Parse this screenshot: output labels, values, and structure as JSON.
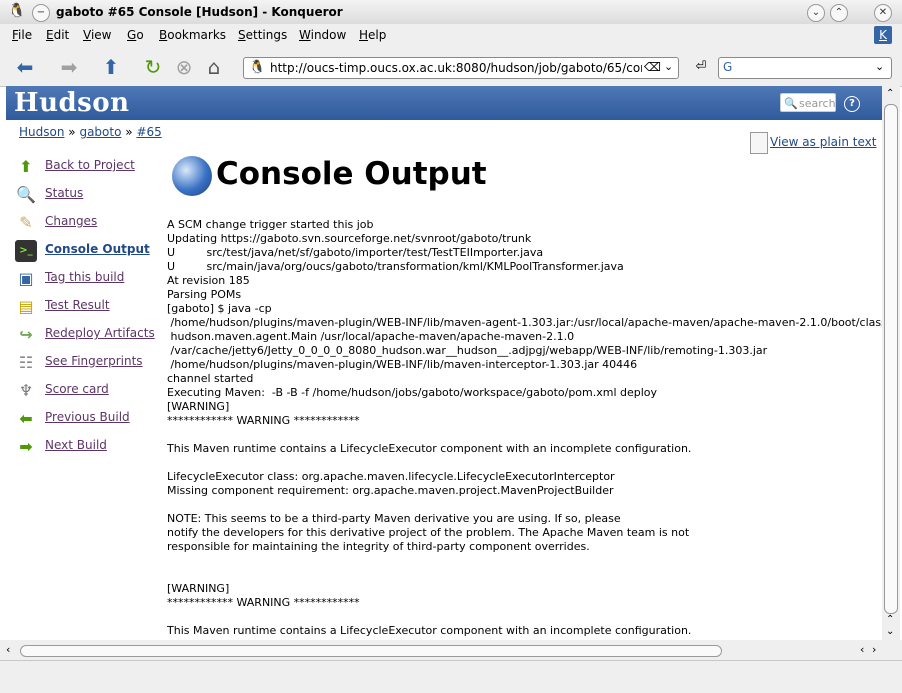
{
  "window": {
    "title": "gaboto #65 Console [Hudson] - Konqueror"
  },
  "menu": [
    "File",
    "Edit",
    "View",
    "Go",
    "Bookmarks",
    "Settings",
    "Window",
    "Help"
  ],
  "address": {
    "url": "http://oucs-timp.oucs.ox.ac.uk:8080/hudson/job/gaboto/65/console"
  },
  "hudson": {
    "logo": "Hudson",
    "search_placeholder": "search",
    "help": "?"
  },
  "breadcrumb": {
    "home": "Hudson",
    "sep1": "»",
    "job": "gaboto",
    "sep2": "»",
    "build": "#65"
  },
  "sidebar": {
    "items": [
      {
        "label": "Back to Project",
        "icon": "up-arrow-icon",
        "color": "#4e9a06"
      },
      {
        "label": "Status",
        "icon": "magnifier-icon",
        "color": "#8aa8c8"
      },
      {
        "label": "Changes",
        "icon": "notepad-icon",
        "color": "#c9a86a"
      },
      {
        "label": "Console Output",
        "icon": "terminal-icon",
        "color": "#333333"
      },
      {
        "label": "Tag this build",
        "icon": "save-icon",
        "color": "#3465a4"
      },
      {
        "label": "Test Result",
        "icon": "clipboard-icon",
        "color": "#c4a000"
      },
      {
        "label": "Redeploy Artifacts",
        "icon": "redeploy-arrow-icon",
        "color": "#73a85a"
      },
      {
        "label": "See Fingerprints",
        "icon": "fingerprint-icon",
        "color": "#888a85"
      },
      {
        "label": "Score card",
        "icon": "joystick-icon",
        "color": "#777777"
      },
      {
        "label": "Previous Build",
        "icon": "left-arrow-icon",
        "color": "#4e9a06"
      },
      {
        "label": "Next Build",
        "icon": "right-arrow-icon",
        "color": "#4e9a06"
      }
    ]
  },
  "plain_text_link": "View as plain text",
  "page_title": "Console Output",
  "console_text": "A SCM change trigger started this job\nUpdating https://gaboto.svn.sourceforge.net/svnroot/gaboto/trunk\nU         src/test/java/net/sf/gaboto/importer/test/TestTEIImporter.java\nU         src/main/java/org/oucs/gaboto/transformation/kml/KMLPoolTransformer.java\nAt revision 185\nParsing POMs\n[gaboto] $ java -cp\n /home/hudson/plugins/maven-plugin/WEB-INF/lib/maven-agent-1.303.jar:/usr/local/apache-maven/apache-maven-2.1.0/boot/classworlds-1.1.jar\n hudson.maven.agent.Main /usr/local/apache-maven/apache-maven-2.1.0\n /var/cache/jetty6/Jetty_0_0_0_0_8080_hudson.war__hudson__.adjpgj/webapp/WEB-INF/lib/remoting-1.303.jar\n /home/hudson/plugins/maven-plugin/WEB-INF/lib/maven-interceptor-1.303.jar 40446\nchannel started\nExecuting Maven:  -B -B -f /home/hudson/jobs/gaboto/workspace/gaboto/pom.xml deploy\n[WARNING]\n************ WARNING ************\n\nThis Maven runtime contains a LifecycleExecutor component with an incomplete configuration.\n\nLifecycleExecutor class: org.apache.maven.lifecycle.LifecycleExecutorInterceptor\nMissing component requirement: org.apache.maven.project.MavenProjectBuilder\n\nNOTE: This seems to be a third-party Maven derivative you are using. If so, please\nnotify the developers for this derivative project of the problem. The Apache Maven team is not\nresponsible for maintaining the integrity of third-party component overrides.\n\n\n[WARNING]\n************ WARNING ************\n\nThis Maven runtime contains a LifecycleExecutor component with an incomplete configuration."
}
